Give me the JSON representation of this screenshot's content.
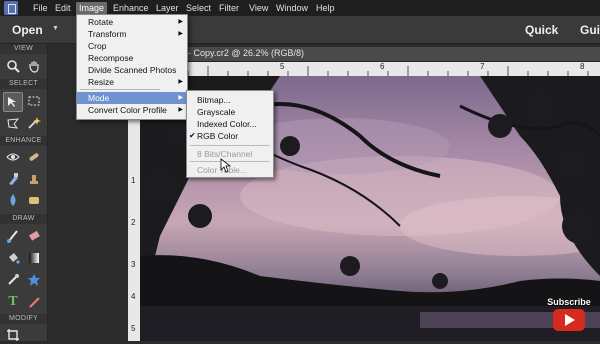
{
  "menubar": {
    "items": [
      "File",
      "Edit",
      "Image",
      "Enhance",
      "Layer",
      "Select",
      "Filter",
      "View",
      "Window",
      "Help"
    ],
    "active_item": "Image"
  },
  "modebar": {
    "open_label": "Open",
    "quick_label": "Quick",
    "guided_label": "Guid"
  },
  "toolpanel": {
    "sections": [
      "VIEW",
      "SELECT",
      "ENHANCE",
      "DRAW",
      "MODIFY"
    ]
  },
  "document": {
    "tab_title": "ac - Copy.cr2 @ 26.2% (RGB/8)",
    "ruler_h": [
      "5",
      "6",
      "7",
      "8"
    ],
    "ruler_v": [
      "1",
      "2",
      "3",
      "4",
      "5"
    ]
  },
  "image_menu": {
    "items": [
      {
        "label": "Rotate",
        "submenu": true
      },
      {
        "label": "Transform",
        "submenu": true
      },
      {
        "label": "Crop",
        "submenu": false
      },
      {
        "label": "Recompose",
        "submenu": false
      },
      {
        "label": "Divide Scanned Photos",
        "submenu": false
      },
      {
        "label": "Resize",
        "submenu": true
      },
      {
        "label": "Mode",
        "submenu": true
      },
      {
        "label": "Convert Color Profile",
        "submenu": true
      }
    ],
    "highlighted": "Mode"
  },
  "mode_menu": {
    "items": [
      {
        "label": "Bitmap...",
        "checked": false,
        "disabled": false
      },
      {
        "label": "Grayscale",
        "checked": false,
        "disabled": false
      },
      {
        "label": "Indexed Color...",
        "checked": false,
        "disabled": false
      },
      {
        "label": "RGB Color",
        "checked": true,
        "disabled": false
      },
      {
        "label": "8 Bits/Channel",
        "checked": false,
        "disabled": true
      },
      {
        "label": "Color Table...",
        "checked": false,
        "disabled": true
      }
    ]
  },
  "subscribe": {
    "label": "Subscribe"
  },
  "colors": {
    "menu_highlight": "#6f93d1",
    "youtube_red": "#d62a1f"
  },
  "icons": [
    "zoom-icon",
    "hand-icon",
    "move-icon",
    "marquee-icon",
    "lasso-icon",
    "magic-wand-icon",
    "eye-icon",
    "brush-healing-icon",
    "smudge-icon",
    "blur-icon",
    "sponge-icon",
    "brush-icon",
    "eraser-icon",
    "paint-bucket-icon",
    "gradient-icon",
    "color-picker-icon",
    "custom-shape-icon",
    "type-icon",
    "pencil-icon",
    "crop-icon"
  ]
}
